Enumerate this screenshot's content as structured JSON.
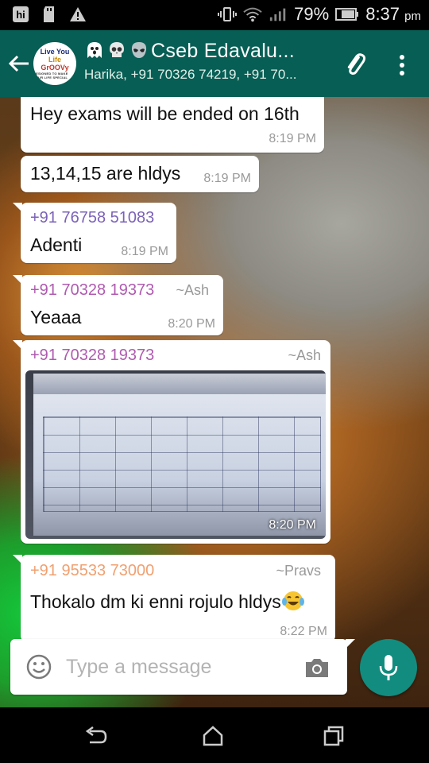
{
  "status_bar": {
    "left_icons": [
      "hike-icon",
      "sd-card-icon",
      "warning-icon"
    ],
    "right_icons": [
      "vibrate-icon",
      "wifi-icon",
      "signal-icon",
      "battery-icon"
    ],
    "battery_percent": "79%",
    "time": "8:37",
    "time_suffix": "pm"
  },
  "header": {
    "avatar_lines": [
      "Live You",
      "Life",
      "GrOOVy",
      "DESIGNED TO MAKE YOUR LIFE SPECIAL"
    ],
    "title": "Cseb Edavalu...",
    "title_emojis": [
      "ghost",
      "skull",
      "alien"
    ],
    "subtitle": "Harika, +91 70326 74219, +91 70...",
    "colors": {
      "primary": "#075e54",
      "accent": "#128c7e"
    }
  },
  "messages": [
    {
      "id": "m1",
      "text": "Hey exams will be ended on 16th",
      "time": "8:19 PM"
    },
    {
      "id": "m2",
      "text": "13,14,15 are hldys",
      "time": "8:19 PM"
    },
    {
      "id": "m3",
      "sender": "+91 76758 51083",
      "sender_color": "#7b62b8",
      "text": "Adenti",
      "time": "8:19 PM"
    },
    {
      "id": "m4",
      "sender": "+91 70328 19373",
      "nickname": "~Ash",
      "sender_color": "#b05ab0",
      "text": "Yeaaa",
      "time": "8:20 PM"
    },
    {
      "id": "m5",
      "sender": "+91 70328 19373",
      "nickname": "~Ash",
      "sender_color": "#b05ab0",
      "image": "exam-timetable-photo",
      "time": "8:20 PM"
    },
    {
      "id": "m6",
      "sender": "+91 95533 73000",
      "nickname": "~Pravs",
      "sender_color": "#f0a070",
      "text": "Thokalo dm ki enni rojulo hldys",
      "emoji": "face-with-tears-of-joy",
      "time": "8:22 PM"
    }
  ],
  "composer": {
    "placeholder": "Type a message"
  },
  "nav": [
    "back-nav",
    "home-nav",
    "recents-nav"
  ]
}
